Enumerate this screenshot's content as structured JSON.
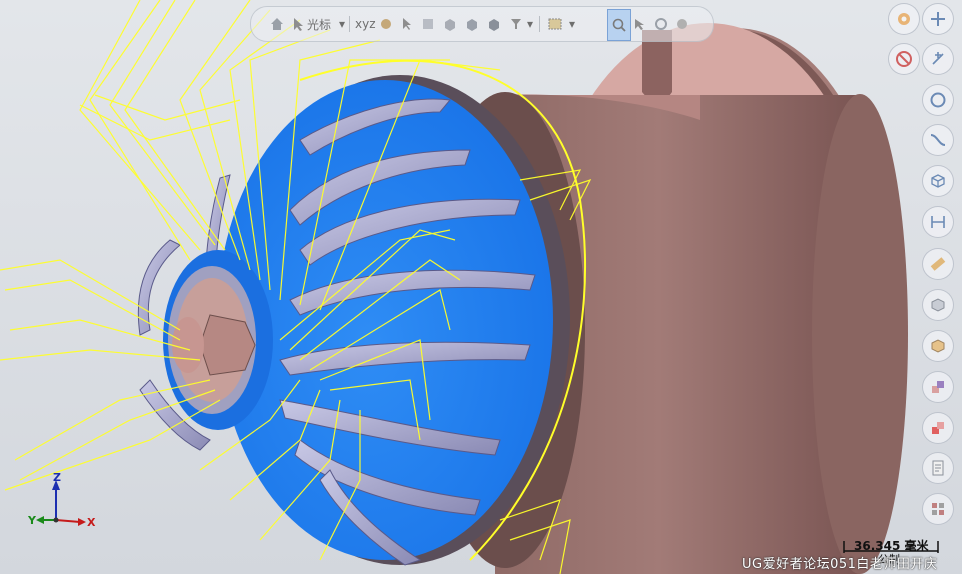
{
  "toolbar": {
    "cursor_label": "光标",
    "xyz_label": "xyz",
    "items": [
      "home-icon",
      "cursor-select-icon",
      "dropdown-arrow",
      "xyz-snap",
      "point-icon",
      "arrow-select-icon",
      "box-select-icon",
      "face-icon",
      "solid-icon",
      "body-icon",
      "edge-icon",
      "filter-icon",
      "dropdown-arrow",
      "rect-select-icon",
      "dropdown-arrow",
      "zoom-highlight-icon",
      "view-icon",
      "rotate-icon",
      "settings-icon"
    ]
  },
  "right_panel": {
    "buttons": [
      "gear-icon",
      "plus-icon",
      "no-entry-icon",
      "add-points-icon",
      "circle-icon",
      "curve-icon",
      "cube-wire-icon",
      "dimension-icon",
      "ruler-icon",
      "box-icon",
      "shaded-box-icon",
      "purple-squares-icon",
      "red-squares-icon",
      "document-icon",
      "grid-icon"
    ]
  },
  "triad": {
    "x": "X",
    "y": "Y",
    "z": "Z"
  },
  "scale": {
    "value": "36.345 毫米",
    "unit": "公制"
  },
  "watermark": "UG爱好者论坛051白老师田开庆",
  "colors": {
    "blade_blue": "#1e7cf0",
    "housing": "#b58682",
    "toolpath": "#ffff2a"
  }
}
